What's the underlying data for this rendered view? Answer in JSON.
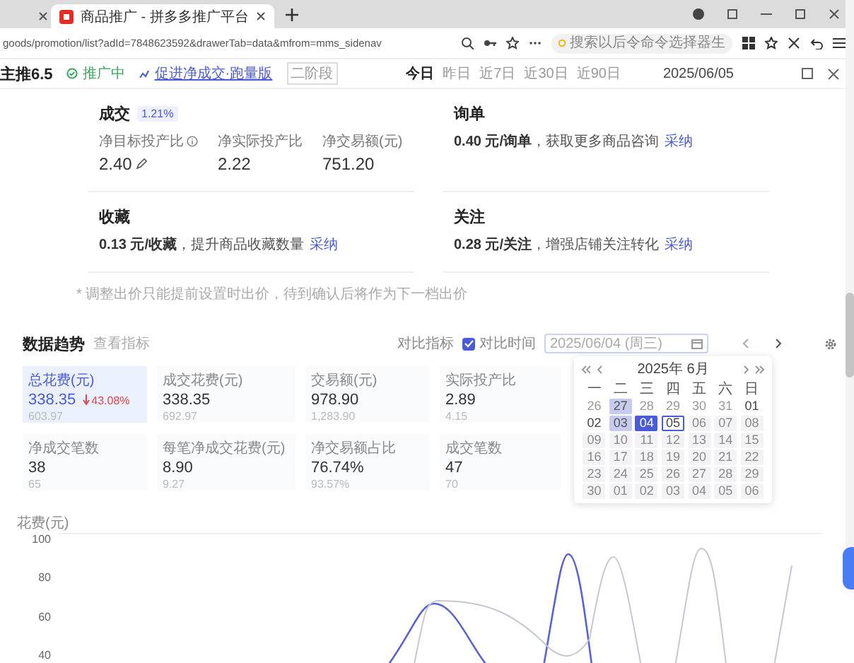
{
  "browser": {
    "tabs": [
      {
        "title": "商品推广 - 拼多多推广平台",
        "selected": true
      }
    ],
    "address": "goods/promotion/list?adId=7848623592&drawerTab=data&mfrom=mms_sidenav",
    "search_placeholder": "搜索以后令命令选择器生"
  },
  "header": {
    "title": "主推6.5",
    "status": "推广中",
    "strategy": "促进净成交·跑量版",
    "stage": "二阶段",
    "ranges": [
      {
        "label": "今日",
        "selected": true
      },
      {
        "label": "昨日",
        "selected": false
      },
      {
        "label": "近7日",
        "selected": false
      },
      {
        "label": "近30日",
        "selected": false
      },
      {
        "label": "近90日",
        "selected": false
      }
    ],
    "date": "2025/06/05"
  },
  "goals": [
    {
      "kind": "metrics",
      "title": "成交",
      "badge": "1.21%",
      "metrics": [
        {
          "label": "净目标投产比",
          "value": "2.40",
          "info": true,
          "editable": true
        },
        {
          "label": "净实际投产比",
          "value": "2.22",
          "info": false,
          "editable": false
        },
        {
          "label": "净交易额(元)",
          "value": "751.20",
          "info": false,
          "editable": false
        }
      ]
    },
    {
      "kind": "bid",
      "title": "询单",
      "price": "0.40 元/询单",
      "desc": "，获取更多商品咨询",
      "action": "采纳"
    },
    {
      "kind": "bid",
      "title": "收藏",
      "price": "0.13 元/收藏",
      "desc": "，提升商品收藏数量",
      "action": "采纳"
    },
    {
      "kind": "bid",
      "title": "关注",
      "price": "0.28 元/关注",
      "desc": "，增强店铺关注转化",
      "action": "采纳"
    }
  ],
  "note": "* 调整出价只能提前设置时出价，待到确认后将作为下一档出价",
  "trend": {
    "title": "数据趋势",
    "subtitle": "查看指标",
    "compare_metric": "对比指标",
    "compare_time": {
      "label": "对比时间",
      "checked": true
    },
    "date_value": "2025/06/04 (周三)",
    "cards": [
      {
        "label": "总花费(元)",
        "value": "338.35",
        "change": {
          "text": "43.08%",
          "falling": true
        },
        "previous": "603.97",
        "selected": true
      },
      {
        "label": "成交花费(元)",
        "value": "338.35",
        "previous": "692.97",
        "selected": false
      },
      {
        "label": "交易额(元)",
        "value": "978.90",
        "previous": "1,283.90",
        "selected": false
      },
      {
        "label": "实际投产比",
        "value": "2.89",
        "previous": "4.15",
        "selected": false
      },
      {
        "label": "净成交笔数",
        "value": "38",
        "previous": "65",
        "selected": false
      },
      {
        "label": "每笔净成交花费(元)",
        "value": "8.90",
        "previous": "9.27",
        "selected": false
      },
      {
        "label": "净交易额占比",
        "value": "76.74%",
        "previous": "93.57%",
        "selected": false
      },
      {
        "label": "成交笔数",
        "value": "47",
        "previous": "70",
        "selected": false
      }
    ]
  },
  "calendar": {
    "title": "2025年 6月",
    "weekdays": [
      "一",
      "二",
      "三",
      "四",
      "五",
      "六",
      "日"
    ],
    "weeks": [
      [
        {
          "day": "26",
          "kind": "other"
        },
        {
          "day": "27",
          "kind": "range"
        },
        {
          "day": "28",
          "kind": "other"
        },
        {
          "day": "29",
          "kind": "other"
        },
        {
          "day": "30",
          "kind": "other"
        },
        {
          "day": "31",
          "kind": "other"
        },
        {
          "day": "01",
          "kind": "normal"
        }
      ],
      [
        {
          "day": "02",
          "kind": "normal"
        },
        {
          "day": "03",
          "kind": "range"
        },
        {
          "day": "04",
          "kind": "selected"
        },
        {
          "day": "05",
          "kind": "today"
        },
        {
          "day": "06",
          "kind": "disabled"
        },
        {
          "day": "07",
          "kind": "disabled"
        },
        {
          "day": "08",
          "kind": "disabled"
        }
      ],
      [
        {
          "day": "09",
          "kind": "disabled"
        },
        {
          "day": "10",
          "kind": "disabled"
        },
        {
          "day": "11",
          "kind": "disabled"
        },
        {
          "day": "12",
          "kind": "disabled"
        },
        {
          "day": "13",
          "kind": "disabled"
        },
        {
          "day": "14",
          "kind": "disabled"
        },
        {
          "day": "15",
          "kind": "disabled"
        }
      ],
      [
        {
          "day": "16",
          "kind": "disabled"
        },
        {
          "day": "17",
          "kind": "disabled"
        },
        {
          "day": "18",
          "kind": "disabled"
        },
        {
          "day": "19",
          "kind": "disabled"
        },
        {
          "day": "20",
          "kind": "disabled"
        },
        {
          "day": "21",
          "kind": "disabled"
        },
        {
          "day": "22",
          "kind": "disabled"
        }
      ],
      [
        {
          "day": "23",
          "kind": "disabled"
        },
        {
          "day": "24",
          "kind": "disabled"
        },
        {
          "day": "25",
          "kind": "disabled"
        },
        {
          "day": "26",
          "kind": "disabled"
        },
        {
          "day": "27",
          "kind": "disabled"
        },
        {
          "day": "28",
          "kind": "disabled"
        },
        {
          "day": "29",
          "kind": "disabled"
        }
      ],
      [
        {
          "day": "30",
          "kind": "disabled"
        },
        {
          "day": "01",
          "kind": "disabled"
        },
        {
          "day": "02",
          "kind": "disabled"
        },
        {
          "day": "03",
          "kind": "disabled"
        },
        {
          "day": "04",
          "kind": "disabled"
        },
        {
          "day": "05",
          "kind": "disabled"
        },
        {
          "day": "06",
          "kind": "disabled"
        }
      ]
    ]
  },
  "chart": {
    "ylabel": "花费(元)",
    "yticks": [
      "100",
      "80",
      "60",
      "40"
    ]
  }
}
